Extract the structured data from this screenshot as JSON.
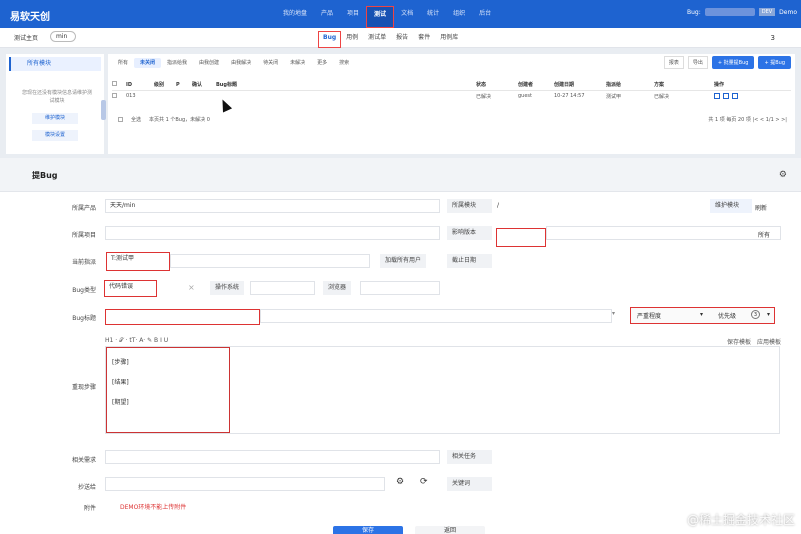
{
  "app": {
    "logo": "易软天创"
  },
  "topnav": {
    "items": [
      "我的地盘",
      "产品",
      "项目",
      "测试",
      "文档",
      "统计",
      "组织",
      "后台"
    ],
    "active_index": 3,
    "bug_label": "Bug:",
    "dev_badge": "DEV",
    "user": "Demo"
  },
  "subnav": {
    "crumb": "测试主页",
    "project": "min",
    "items": [
      "Bug",
      "用例",
      "测试单",
      "报告",
      "套件",
      "用例库"
    ],
    "active_index": 0,
    "counter": "3"
  },
  "leftpanel": {
    "header": "所有模块",
    "empty_text": "您现在还没有模块信息请维护测试模块",
    "btn_maintain": "维护模块",
    "btn_settings": "模块设置"
  },
  "list": {
    "filters": [
      "所有",
      "未关闭",
      "指派给我",
      "由我创建",
      "由我解决",
      "待关闭",
      "未解决",
      "更多"
    ],
    "active_filter": 1,
    "search": "搜索",
    "actions": {
      "report": "报表",
      "export": "导出",
      "batch": "+ 批量提Bug",
      "new": "+ 提Bug"
    },
    "columns": [
      "ID",
      "级别",
      "P",
      "确认",
      "Bug标题",
      "状态",
      "创建者",
      "创建日期",
      "指派给",
      "方案",
      "操作"
    ],
    "rows": [
      {
        "id": "013",
        "level": "",
        "p": "",
        "confirm": "",
        "title": "",
        "status": "已解决",
        "creator": "guest",
        "date": "10-27 14:57",
        "assignee": "测试甲",
        "solution": "已解决"
      }
    ],
    "footer": {
      "select_all": "全选",
      "summary": "本页共 1 个Bug，未解决 0",
      "pager": "共 1 项  每页 20 项  |<  <  1/1  >  >|"
    }
  },
  "form": {
    "title": "提Bug",
    "product_label": "所属产品",
    "product_value": "天天/min",
    "module_label": "所属模块",
    "module_value": "/",
    "maintain_module": "维护模块",
    "refresh": "刷新",
    "project_label": "所属项目",
    "build_label": "影响版本",
    "all": "所有",
    "assignee_label": "当前指派",
    "assignee_value": "T:测试甲",
    "load_users": "加载所有用户",
    "deadline_label": "截止日期",
    "type_label": "Bug类型",
    "type_value": "代码错误",
    "os_label": "操作系统",
    "browser_label": "浏览器",
    "bug_title_label": "Bug标题",
    "severity_label": "严重程度",
    "priority_label": "优先级",
    "priority_value": "3",
    "editor_tools": "H1  ·  𝒯  ·  tT·   A·   ✎   B   I   U",
    "save_template": "保存模板",
    "apply_template": "应用模板",
    "steps_label": "重现步骤",
    "steps": [
      "[步骤]",
      "[结果]",
      "[期望]"
    ],
    "story_label": "相关需求",
    "task_label": "相关任务",
    "cc_label": "抄送给",
    "keywords_label": "关键词",
    "attach_label": "附件",
    "attach_note": "DEMO环境不能上传附件",
    "save": "保存",
    "back": "返回"
  },
  "watermark": "@稀土掘金技术社区"
}
